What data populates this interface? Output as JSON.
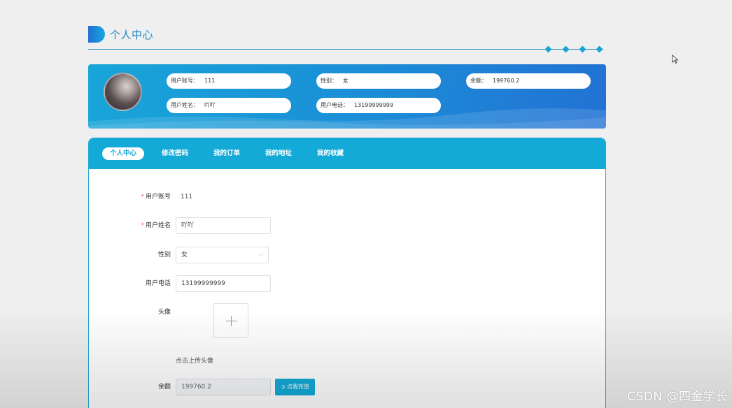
{
  "header": {
    "title": "个人中心"
  },
  "info": {
    "account_label": "用户账号：",
    "account_value": "111",
    "gender_label": "性别：",
    "gender_value": "女",
    "balance_label": "余额：",
    "balance_value": "199760.2",
    "name_label": "用户姓名：",
    "name_value": "吖吖",
    "phone_label": "用户电话：",
    "phone_value": "13199999999"
  },
  "tabs": [
    {
      "label": "个人中心",
      "active": true
    },
    {
      "label": "修改密码"
    },
    {
      "label": "我的订单"
    },
    {
      "label": "我的地址"
    },
    {
      "label": "我的收藏"
    }
  ],
  "form": {
    "account_label": "用户账号",
    "account_value": "111",
    "name_label": "用户姓名",
    "name_value": "吖吖",
    "gender_label": "性别",
    "gender_value": "女",
    "phone_label": "用户电话",
    "phone_value": "13199999999",
    "avatar_label": "头像",
    "upload_tip": "点击上传头像",
    "balance_label": "余额",
    "balance_value": "199760.2",
    "recharge_label": "点我充值",
    "required_mark": "*"
  },
  "icons": {
    "avatar_upload": "plus-icon",
    "recharge": "circle-arrow-icon",
    "gender_select": "chevron-down-icon",
    "cursor": "mouse-pointer-icon"
  },
  "colors": {
    "primary": "#13aad7",
    "accent": "#1a86c9",
    "required": "#f56c6c"
  },
  "watermark": "CSDN @四金学长"
}
